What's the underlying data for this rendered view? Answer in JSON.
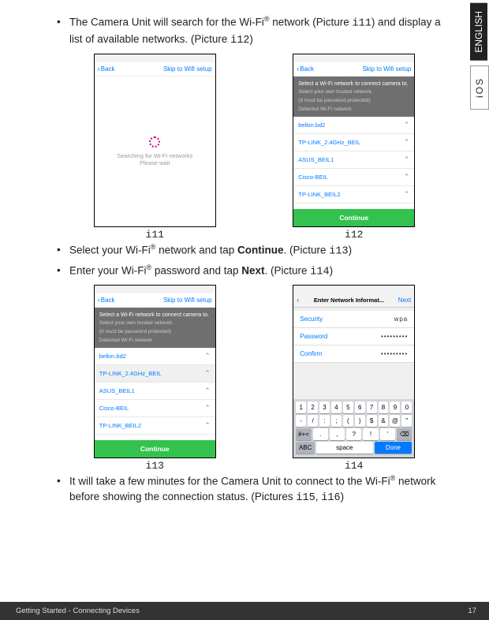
{
  "sideTabs": {
    "lang": "ENGLISH",
    "os": "iOS"
  },
  "bullets": {
    "b1a": "The Camera Unit will search for the Wi-Fi",
    "b1b": " network (Picture ",
    "b1c": ") and display a list of available networks. (Picture ",
    "b1d": ")",
    "b2a": "Select your Wi-Fi",
    "b2b": " network and tap ",
    "b2c": ". (Picture ",
    "b2d": ")",
    "b3a": "Enter your Wi-Fi",
    "b3b": " password and tap ",
    "b3c": ". (Picture ",
    "b3d": ")",
    "b4a": "It will take a few minutes for the Camera Unit to connect to the Wi-Fi",
    "b4b": " network before showing the connection status. (Pictures ",
    "b4c": ", ",
    "b4d": ")",
    "reg": "®",
    "continue": "Continue",
    "next": "Next"
  },
  "refs": {
    "i11": "i11",
    "i12": "i12",
    "i13": "i13",
    "i14": "i14",
    "i15": "i15",
    "i16": "i16"
  },
  "nav": {
    "back": "Back",
    "skip": "Skip to Wifi setup",
    "enterNet": "Enter Network Informat...",
    "nextBtn": "Next"
  },
  "i11": {
    "line1": "Searching for Wi-Fi networks",
    "line2": "Please wait"
  },
  "netHeader": {
    "title": "Select a Wi-Fi network to connect camera to.",
    "sub1": "Select your own trusted network.",
    "sub2": "(It must be password protected)",
    "sub3": "Detected Wi-Fi network"
  },
  "networks": [
    "belkin.bd2",
    "TP-LINK_2.4GHz_BEIL",
    "ASUS_BEIL1",
    "Cisco-BEIL",
    "TP-LINK_BEIL2"
  ],
  "continueBtn": "Continue",
  "i14": {
    "security": "Security",
    "securityVal": "wpa",
    "password": "Password",
    "passwordVal": "•••••••••",
    "confirm": "Confirm",
    "confirmVal": "•••••••••"
  },
  "kbd": {
    "r1": [
      "1",
      "2",
      "3",
      "4",
      "5",
      "6",
      "7",
      "8",
      "9",
      "0"
    ],
    "r2": [
      "-",
      "/",
      ":",
      ";",
      "(",
      ")",
      "$",
      "&",
      "@",
      "\""
    ],
    "r3": [
      ".",
      ",",
      "?",
      "!",
      "'"
    ],
    "shift": "#+=",
    "bksp": "⌫",
    "abc": "ABC",
    "space": "space",
    "done": "Done"
  },
  "footer": {
    "left": "Getting Started - Connecting Devices",
    "page": "17"
  }
}
